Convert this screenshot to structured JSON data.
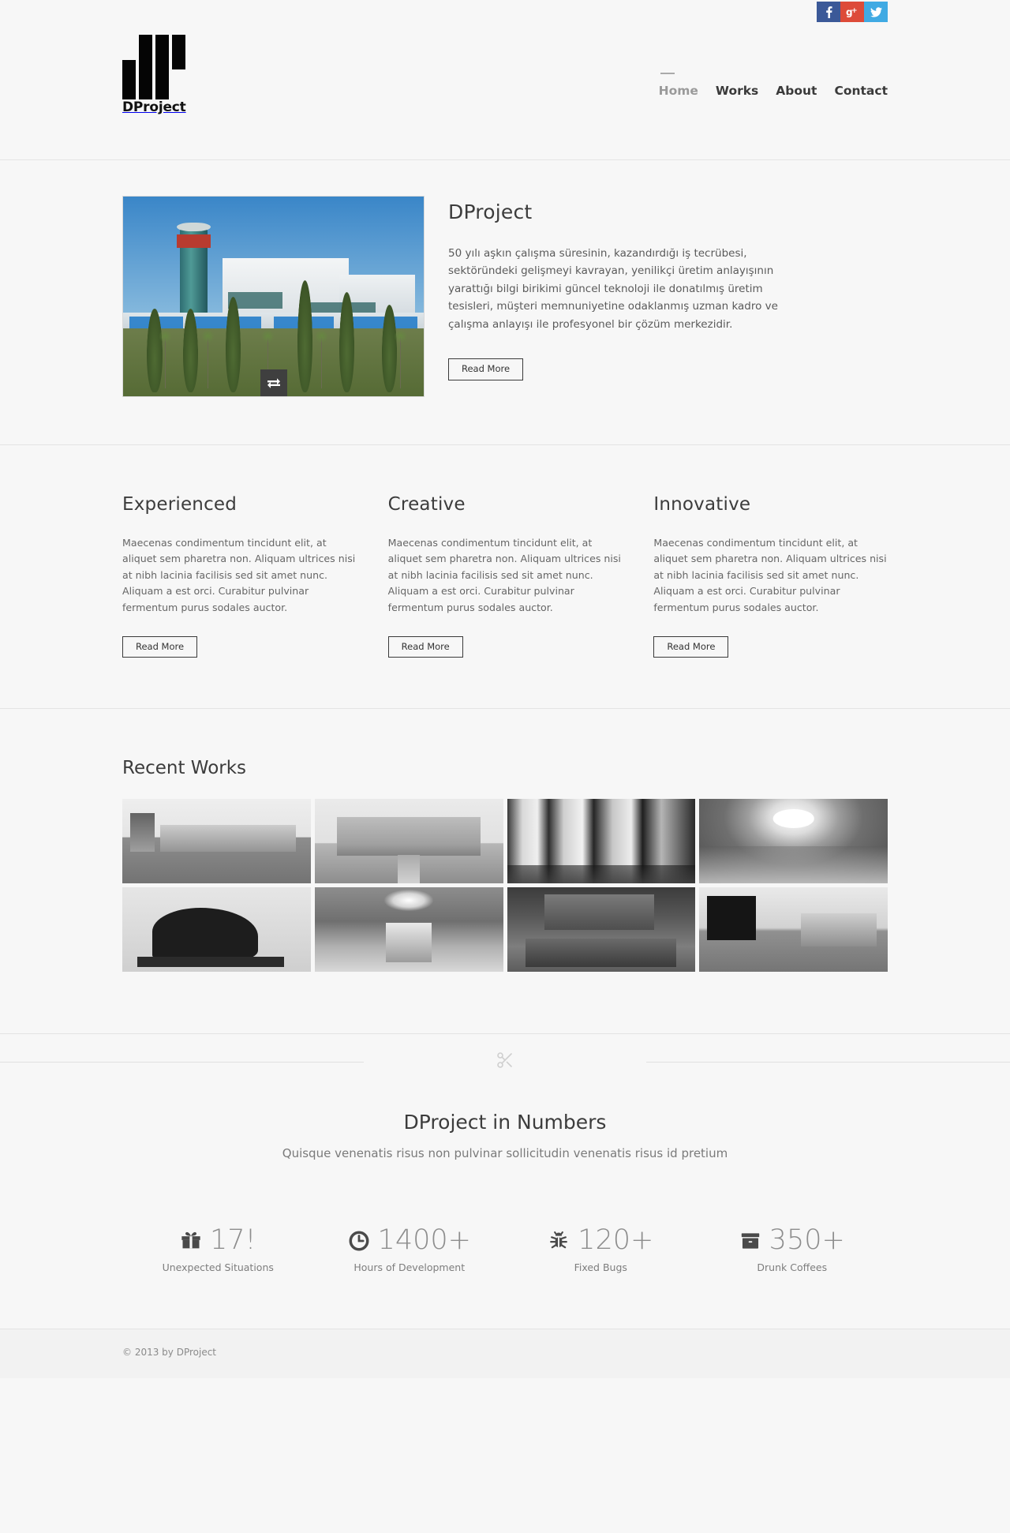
{
  "social": [
    {
      "name": "facebook",
      "label": "f",
      "color": "#3b5998"
    },
    {
      "name": "googleplus",
      "label": "g+",
      "color": "#dd4b39"
    },
    {
      "name": "twitter",
      "label": "t",
      "color": "#40aae3"
    }
  ],
  "brand": {
    "name": "DProject"
  },
  "nav": {
    "items": [
      {
        "label": "Home",
        "active": true
      },
      {
        "label": "Works",
        "active": false
      },
      {
        "label": "About",
        "active": false
      },
      {
        "label": "Contact",
        "active": false
      }
    ]
  },
  "hero": {
    "title": "DProject",
    "text": "50 yılı aşkın çalışma süresinin, kazandırdığı iş tecrübesi, sektöründeki gelişmeyi kavrayan, yenilikçi üretim anlayışının yarattığı bilgi birikimi güncel teknoloji ile donatılmış üretim tesisleri, müşteri memnuniyetine odaklanmış uzman kadro ve çalışma anlayışı ile profesyonel bir çözüm merkezidir.",
    "button": "Read More",
    "slider_control_icon": "swap-arrows-icon",
    "image_alt": "Modern building complex with glass tower and cypress trees"
  },
  "features": [
    {
      "title": "Experienced",
      "text": "Maecenas condimentum tincidunt elit, at aliquet sem pharetra non. Aliquam ultrices nisi at nibh lacinia facilisis sed sit amet nunc. Aliquam a est orci. Curabitur pulvinar fermentum purus sodales auctor.",
      "button": "Read More"
    },
    {
      "title": "Creative",
      "text": "Maecenas condimentum tincidunt elit, at aliquet sem pharetra non. Aliquam ultrices nisi at nibh lacinia facilisis sed sit amet nunc. Aliquam a est orci. Curabitur pulvinar fermentum purus sodales auctor.",
      "button": "Read More"
    },
    {
      "title": "Innovative",
      "text": "Maecenas condimentum tincidunt elit, at aliquet sem pharetra non. Aliquam ultrices nisi at nibh lacinia facilisis sed sit amet nunc. Aliquam a est orci. Curabitur pulvinar fermentum purus sodales auctor.",
      "button": "Read More"
    }
  ],
  "works": {
    "title": "Recent Works",
    "items": [
      {
        "alt": "Exterior complex with landscaped plaza"
      },
      {
        "alt": "Large hotel facade with walkway"
      },
      {
        "alt": "Illuminated elevator lobby corridor"
      },
      {
        "alt": "Domed atrium lobby interior"
      },
      {
        "alt": "Bronze horse sculpture"
      },
      {
        "alt": "Chandelier hall with fountain"
      },
      {
        "alt": "Executive office with leather armchairs"
      },
      {
        "alt": "Modern lounge with armchairs by windows"
      }
    ]
  },
  "divider": {
    "icon": "scissors-icon"
  },
  "numbers": {
    "title": "DProject in Numbers",
    "subtitle": "Quisque venenatis risus non pulvinar sollicitudin venenatis risus id pretium",
    "stats": [
      {
        "icon": "gift-icon",
        "value": "17!",
        "label": "Unexpected Situations"
      },
      {
        "icon": "clock-icon",
        "value": "1400+",
        "label": "Hours of Development"
      },
      {
        "icon": "bug-icon",
        "value": "120+",
        "label": "Fixed Bugs"
      },
      {
        "icon": "archive-box-icon",
        "value": "350+",
        "label": "Drunk Coffees"
      }
    ]
  },
  "footer": {
    "copyright": "© 2013 by DProject"
  }
}
